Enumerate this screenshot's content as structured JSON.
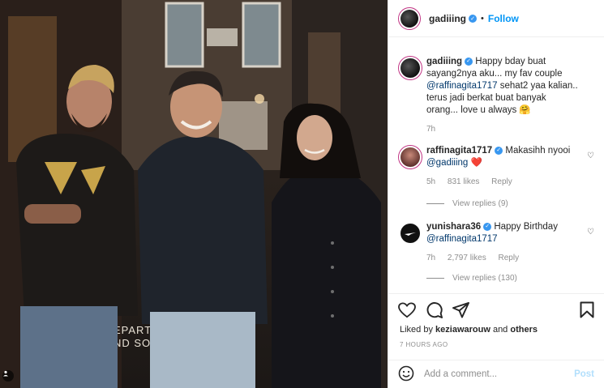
{
  "photo": {
    "sign_lines": [
      "EPART",
      "ND SOC"
    ]
  },
  "header": {
    "username": "gadiiing",
    "separator": "•",
    "follow_label": "Follow"
  },
  "caption": {
    "username": "gadiiing",
    "text_1": " Happy bday buat sayang2nya aku... my fav couple ",
    "mention": "@raffinagita1717",
    "text_2": " sehat2 yaa kalian.. terus jadi berkat buat banyak orang... love u always 🤗",
    "time": "7h"
  },
  "comments": [
    {
      "username": "raffinagita1717",
      "text_1": " Makasihh nyooi ",
      "mention": "@gadiiing",
      "emoji": "❤️",
      "time": "5h",
      "likes": "831 likes",
      "reply": "Reply",
      "view_replies": "View replies (9)"
    },
    {
      "username": "yunishara36",
      "text_1": " Happy Birthday ",
      "mention": "@raffinagita1717",
      "time": "7h",
      "likes": "2,797 likes",
      "reply": "Reply",
      "view_replies": "View replies (130)"
    }
  ],
  "actions": {
    "liked_by_prefix": "Liked by ",
    "liked_by_user": "keziawarouw",
    "liked_by_and": " and ",
    "liked_by_others": "others",
    "timestamp": "7 HOURS AGO"
  },
  "add_comment": {
    "placeholder": "Add a comment...",
    "post_label": "Post"
  },
  "colors": {
    "accent": "#0095f6",
    "verified": "#3897f0",
    "mention": "#00376b",
    "muted": "#8e8e8e",
    "post_disabled": "#b2dffc"
  }
}
